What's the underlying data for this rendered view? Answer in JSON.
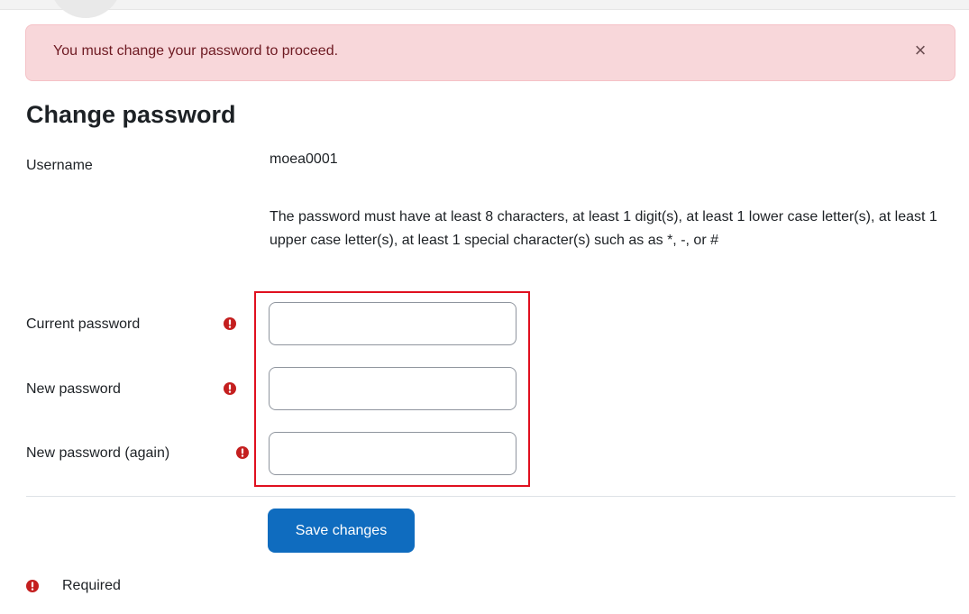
{
  "alert": {
    "message": "You must change your password to proceed.",
    "close_glyph": "×"
  },
  "page": {
    "title": "Change password"
  },
  "form": {
    "username_label": "Username",
    "username_value": "moea0001",
    "password_rules": "The password must have at least 8 characters, at least 1 digit(s), at least 1 lower case letter(s), at least 1 upper case letter(s), at least 1 special character(s) such as as *, -, or #",
    "current_password_label": "Current password",
    "new_password_label": "New password",
    "new_password_again_label": "New password (again)",
    "current_password_value": "",
    "new_password_value": "",
    "new_password_again_value": "",
    "save_label": "Save changes",
    "required_legend": "Required"
  },
  "icons": {
    "required": "exclamation-circle-icon",
    "close": "close-icon"
  },
  "colors": {
    "alert_bg": "#f8d7da",
    "alert_text": "#6e1a22",
    "required_icon": "#c41f1f",
    "primary_button": "#0f6cbf",
    "highlight_border": "#e0101f"
  }
}
